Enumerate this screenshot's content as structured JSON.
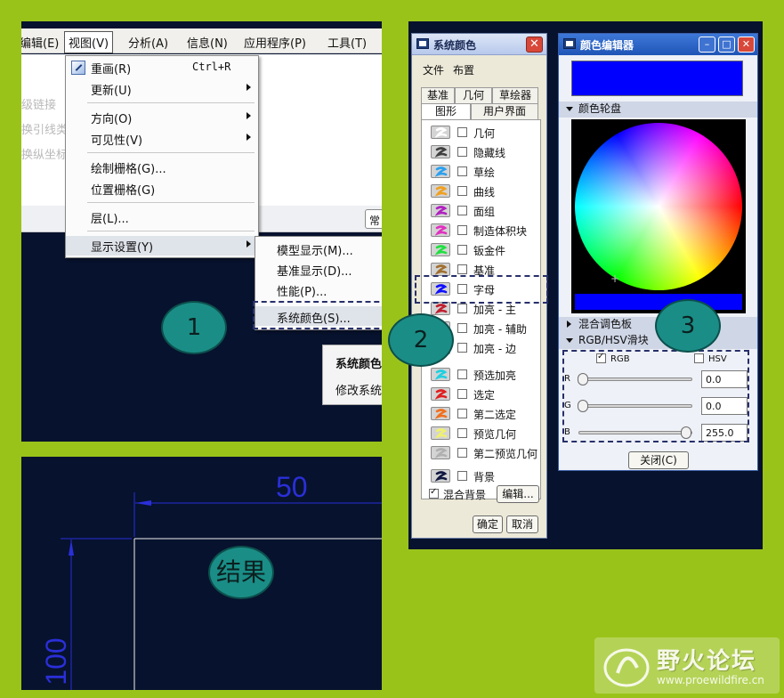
{
  "panel1": {
    "menubar": [
      "编辑(E)",
      "视图(V)",
      "分析(A)",
      "信息(N)",
      "应用程序(P)",
      "工具(T)"
    ],
    "ghost_text": [
      "级链接",
      "换引线类",
      "换纵坐标"
    ],
    "strip_button": "常",
    "view_menu": {
      "items": [
        {
          "label": "重画(R)",
          "shortcut": "Ctrl+R",
          "submenu": false
        },
        {
          "label": "更新(U)",
          "shortcut": "",
          "submenu": true
        },
        {
          "label": "方向(O)",
          "shortcut": "",
          "submenu": true
        },
        {
          "label": "可见性(V)",
          "shortcut": "",
          "submenu": true
        },
        {
          "label": "绘制栅格(G)...",
          "shortcut": "",
          "submenu": false
        },
        {
          "label": "位置栅格(G)",
          "shortcut": "",
          "submenu": false
        },
        {
          "label": "层(L)...",
          "shortcut": "",
          "submenu": false
        },
        {
          "label": "显示设置(Y)",
          "shortcut": "",
          "submenu": true
        }
      ]
    },
    "display_submenu": [
      "模型显示(M)...",
      "基准显示(D)...",
      "性能(P)...",
      "系统颜色(S)..."
    ],
    "tooltip": {
      "title": "系统颜色",
      "desc": "修改系统颜"
    }
  },
  "markers": {
    "one": "1",
    "two": "2",
    "three": "3",
    "result": "结果"
  },
  "result": {
    "dim_top": "50",
    "dim_left": "100",
    "line_color": "#2a2fd8"
  },
  "sys_colors": {
    "title": "系统颜色",
    "menu": [
      "文件",
      "布置"
    ],
    "tabs_row1": [
      "基准",
      "几何",
      "草绘器"
    ],
    "tabs_row2": [
      "图形",
      "用户界面"
    ],
    "rows": [
      {
        "label": "几何",
        "color": "#ffffff",
        "checked": false
      },
      {
        "label": "隐藏线",
        "color": "#404040",
        "checked": false
      },
      {
        "label": "草绘",
        "color": "#2aa0f0",
        "checked": false
      },
      {
        "label": "曲线",
        "color": "#f0a020",
        "checked": false
      },
      {
        "label": "面组",
        "color": "#b020c0",
        "checked": false
      },
      {
        "label": "制造体积块",
        "color": "#e030c0",
        "checked": false
      },
      {
        "label": "钣金件",
        "color": "#20e040",
        "checked": false
      },
      {
        "label": "基准",
        "color": "#a07030",
        "checked": false
      },
      {
        "label": "字母",
        "color": "#1010ff",
        "checked": false
      },
      {
        "label": "加亮 - 主",
        "color": "#c02030",
        "checked": false
      },
      {
        "label": "加亮 - 辅助",
        "color": "#f0f0f0",
        "checked": false
      },
      {
        "label": "加亮 - 边",
        "color": "#20c0c0",
        "checked": false
      },
      {
        "label": "预选加亮",
        "color": "#20d0e0",
        "checked": false
      },
      {
        "label": "选定",
        "color": "#e02020",
        "checked": false
      },
      {
        "label": "第二选定",
        "color": "#f07020",
        "checked": false
      },
      {
        "label": "预览几何",
        "color": "#f0f070",
        "checked": false
      },
      {
        "label": "第二预览几何",
        "color": "#b0b0b0",
        "checked": false
      },
      {
        "label": "背景",
        "color": "#101840",
        "checked": false
      },
      {
        "label": "混合背景",
        "color": "",
        "checked": true
      }
    ],
    "edit_button": "编辑...",
    "ok_button": "确定",
    "cancel_button": "取消"
  },
  "color_editor": {
    "title": "颜色编辑器",
    "preview_color": "#0000ff",
    "section_wheel": "颜色轮盘",
    "section_mix": "混合调色板",
    "section_sliders": "RGB/HSV滑块",
    "mode_rgb": "RGB",
    "mode_hsv": "HSV",
    "rgb_checked": true,
    "hsv_checked": false,
    "sliders": [
      {
        "label": "R",
        "value": "0.0",
        "fraction": 0.0
      },
      {
        "label": "G",
        "value": "0.0",
        "fraction": 0.0
      },
      {
        "label": "B",
        "value": "255.0",
        "fraction": 1.0
      }
    ],
    "close_button": "关闭(C)"
  },
  "watermark": {
    "text": "野火论坛",
    "url": "www.proewildfire.cn"
  }
}
